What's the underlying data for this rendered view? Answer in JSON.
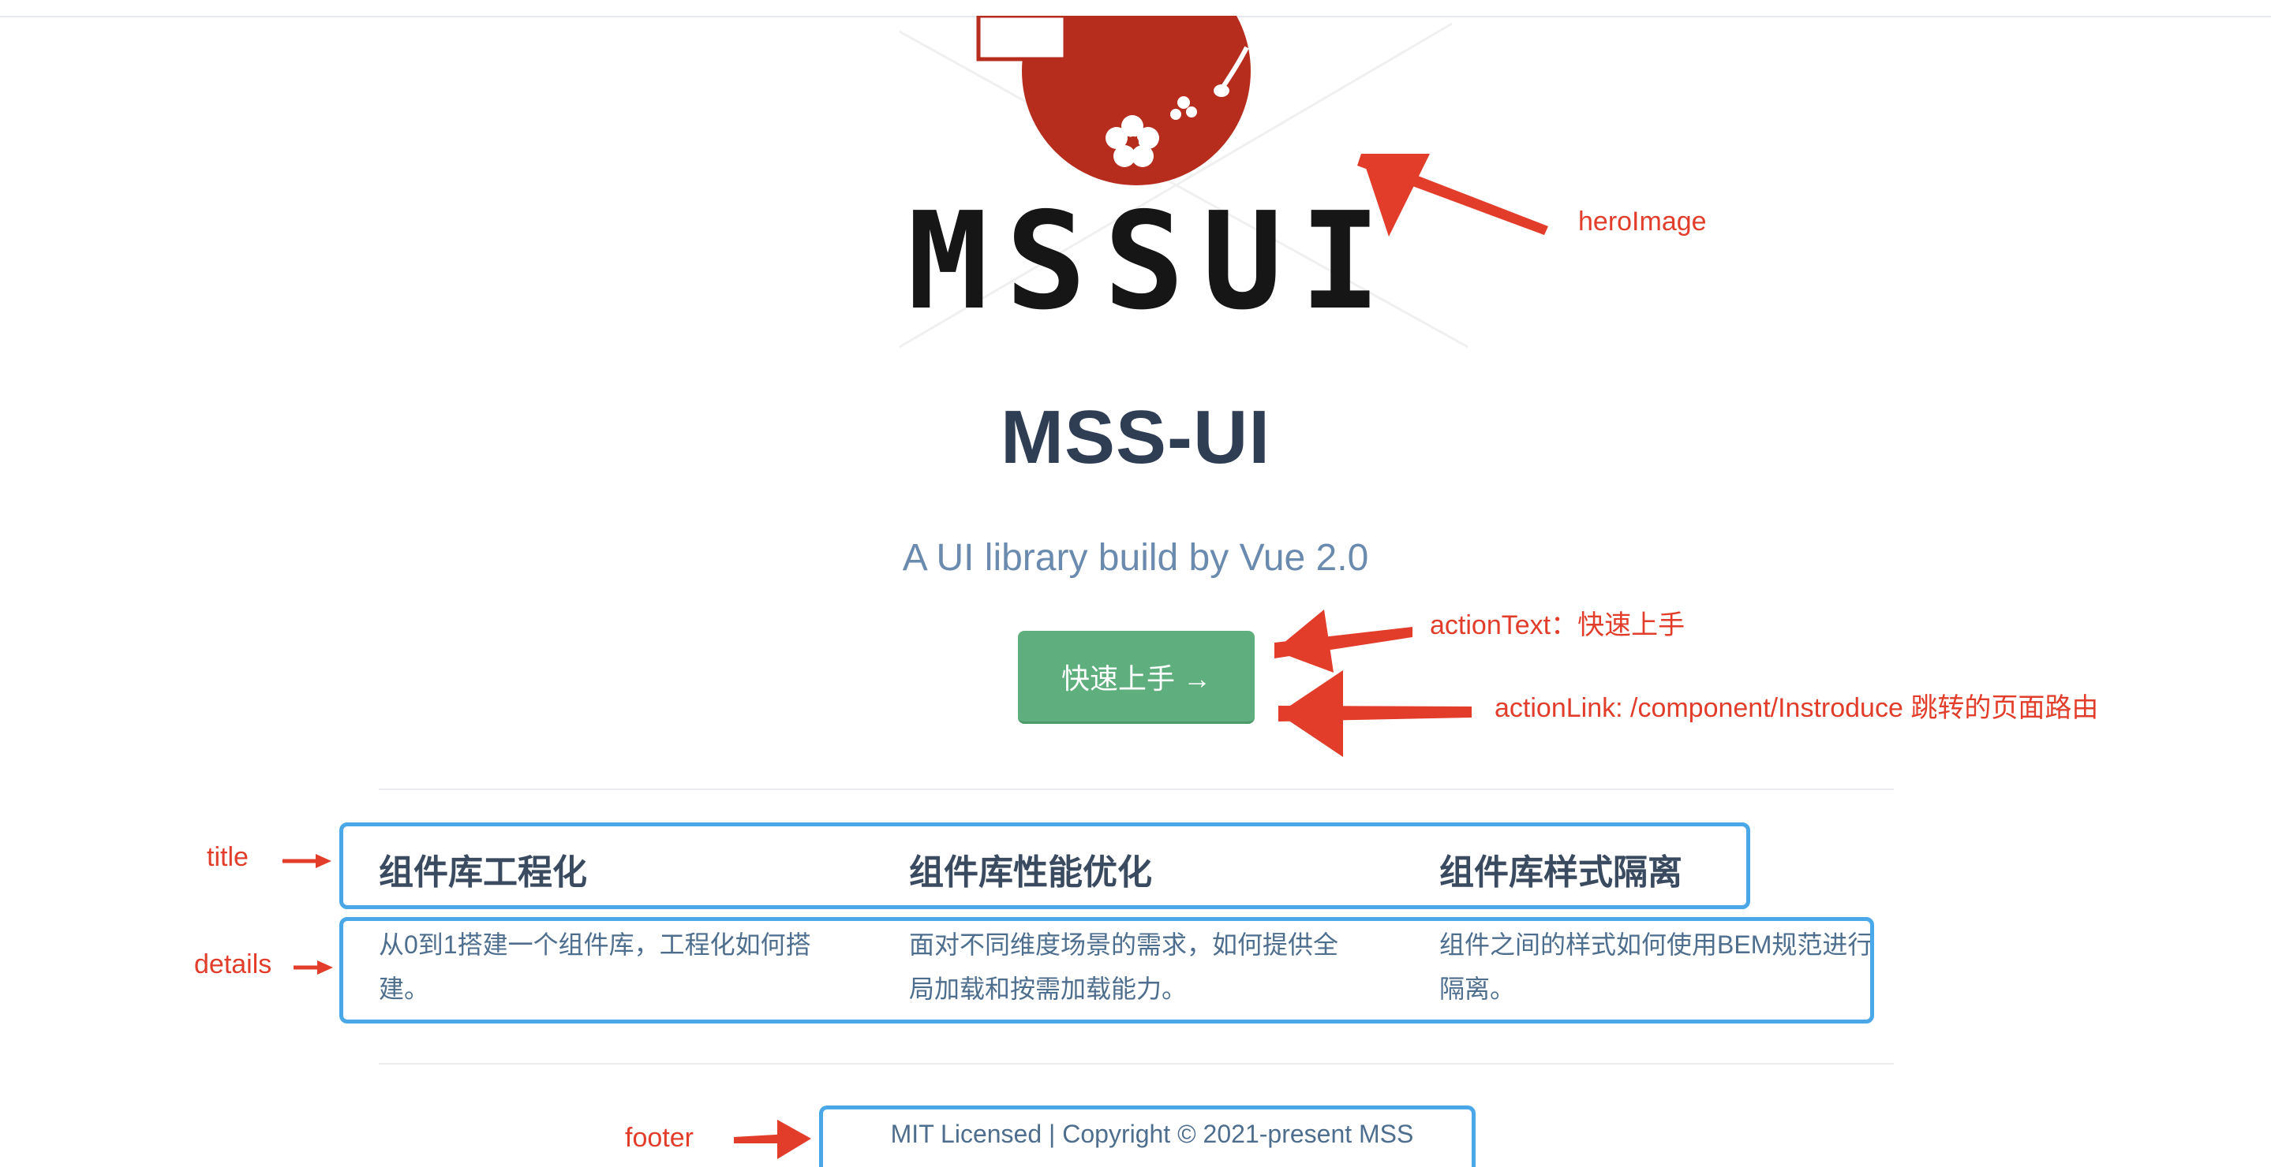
{
  "hero": {
    "logo_text": "MSSUI",
    "title": "MSS-UI",
    "description": "A UI library build by Vue 2.0",
    "action_text": "快速上手 →"
  },
  "features": [
    {
      "title": "组件库工程化",
      "details": "从0到1搭建一个组件库，工程化如何搭建。"
    },
    {
      "title": "组件库性能优化",
      "details": "面对不同维度场景的需求，如何提供全局加载和按需加载能力。"
    },
    {
      "title": "组件库样式隔离",
      "details": "组件之间的样式如何使用BEM规范进行隔离。"
    }
  ],
  "footer": {
    "text": "MIT Licensed | Copyright © 2021-present MSS"
  },
  "annotations": {
    "hero_image": "heroImage",
    "action_text": "actionText：快速上手",
    "action_link": "actionLink: /component/Instroduce 跳转的页面路由",
    "title": "title",
    "details": "details",
    "footer": "footer"
  },
  "colors": {
    "accent_green": "#5fae7e",
    "annotation_red": "#e23d2a",
    "annotation_blue": "#4aa8e8",
    "logo_red": "#b62d1d"
  }
}
